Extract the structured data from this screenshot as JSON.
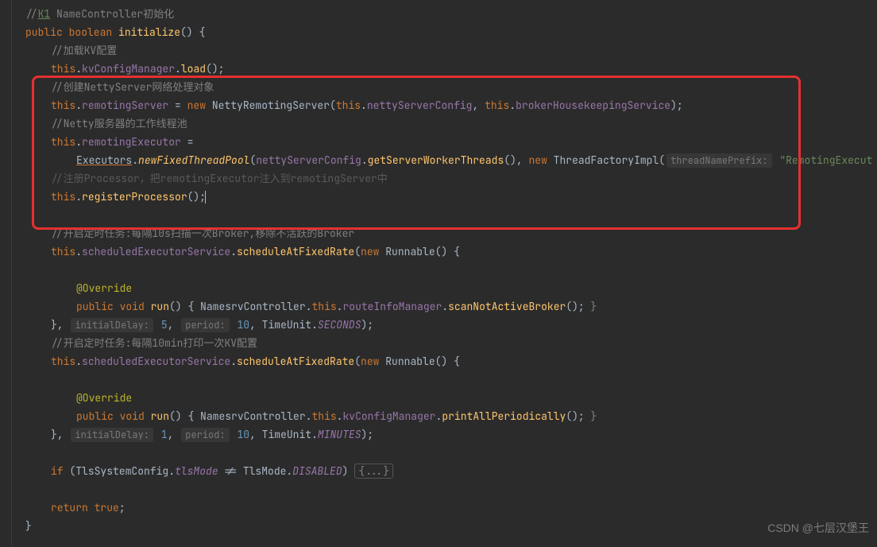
{
  "watermark": "CSDN @七层汉堡王",
  "c0": "//",
  "k1": "K1",
  "c0b": " NameController初始化",
  "l1_public": "public ",
  "l1_boolean": "boolean ",
  "l1_method": "initialize",
  "l1_paren": "() ",
  "l1_brace": "{",
  "l2_comment": "//加载KV配置",
  "l3_this": "this",
  "l3_dot": ".",
  "l3_field": "kvConfigManager",
  "l3_method": "load",
  "l3_end": "();",
  "l4_comment": "//创建NettyServer网络处理对象",
  "l5_this": "this",
  "l5_field": "remotingServer",
  "l5_eq": " = ",
  "l5_new": "new ",
  "l5_class": "NettyRemotingServer",
  "l5_p1": "(",
  "l5_this2": "this",
  "l5_field2": "nettyServerConfig",
  "l5_comma": ", ",
  "l5_this3": "this",
  "l5_field3": "brokerHousekeepingService",
  "l5_end": ");",
  "l6_comment": "//Netty服务器的工作线程池",
  "l7_this": "this",
  "l7_field": "remotingExecutor",
  "l7_eq": " =",
  "l8_class": "Executors",
  "l8_method": "newFixedThreadPool",
  "l8_p1": "(",
  "l8_arg1": "nettyServerConfig",
  "l8_method2": "getServerWorkerThreads",
  "l8_p2": "(), ",
  "l8_new": "new ",
  "l8_class2": "ThreadFactoryImpl",
  "l8_p3": "(",
  "l8_hint": "threadNamePrefix:",
  "l8_str": "\"RemotingExecut",
  "l9_comment": "//注册Processor，把remotingExecutor注入到remotingServer中",
  "l10_this": "this",
  "l10_method": "registerProcessor",
  "l10_end": "();",
  "l12_comment": "//开启定时任务:每隔10s扫描一次Broker,移除不活跃的Broker",
  "l13_this": "this",
  "l13_field": "scheduledExecutorService",
  "l13_method": "scheduleAtFixedRate",
  "l13_p1": "(",
  "l13_new": "new ",
  "l13_class": "Runnable",
  "l13_p2": "() {",
  "l15_ann": "@Override",
  "l16_public": "public ",
  "l16_void": "void ",
  "l16_method": "run",
  "l16_p": "() ",
  "l16_b1": "{ ",
  "l16_class": "NamesrvController",
  "l16_dot": ".",
  "l16_this": "this",
  "l16_field": "routeInfoManager",
  "l16_method2": "scanNotActiveBroker",
  "l16_end": "(); ",
  "l16_b2": "}",
  "l17_b1": "}, ",
  "l17_h1": "initialDelay:",
  "l17_n1": "5",
  "l17_c1": ", ",
  "l17_h2": "period:",
  "l17_n2": "10",
  "l17_c2": ", TimeUnit.",
  "l17_static": "SECONDS",
  "l17_end": ");",
  "l18_comment": "//开启定时任务:每隔10min打印一次KV配置",
  "l19_this": "this",
  "l19_field": "scheduledExecutorService",
  "l19_method": "scheduleAtFixedRate",
  "l19_p1": "(",
  "l19_new": "new ",
  "l19_class": "Runnable",
  "l19_p2": "() {",
  "l21_ann": "@Override",
  "l22_public": "public ",
  "l22_void": "void ",
  "l22_method": "run",
  "l22_p": "() ",
  "l22_b1": "{ ",
  "l22_class": "NamesrvController",
  "l22_dot": ".",
  "l22_this": "this",
  "l22_field": "kvConfigManager",
  "l22_method2": "printAllPeriodically",
  "l22_end": "(); ",
  "l22_b2": "}",
  "l23_b1": "}, ",
  "l23_h1": "initialDelay:",
  "l23_n1": "1",
  "l23_c1": ", ",
  "l23_h2": "period:",
  "l23_n2": "10",
  "l23_c2": ", TimeUnit.",
  "l23_static": "MINUTES",
  "l23_end": ");",
  "l25_if": "if ",
  "l25_p1": "(TlsSystemConfig.",
  "l25_static": "tlsMode",
  "l25_ne": " != TlsMode.",
  "l25_static2": "DISABLED",
  "l25_p2": ") ",
  "l25_fold": "{...}",
  "l27_return": "return ",
  "l27_true": "true",
  "l27_semi": ";",
  "l28_brace": "}"
}
